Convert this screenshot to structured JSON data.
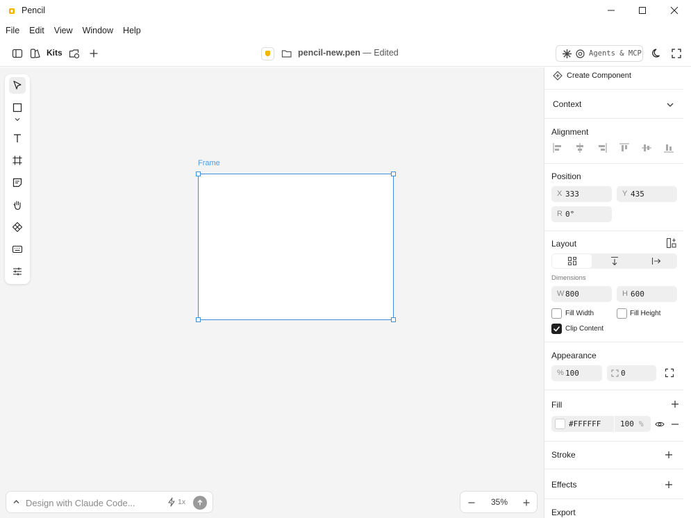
{
  "window": {
    "title": "Pencil",
    "controls": [
      "minimize",
      "maximize",
      "close"
    ]
  },
  "menu": [
    "File",
    "Edit",
    "View",
    "Window",
    "Help"
  ],
  "toolbar": {
    "kits_label": "Kits",
    "file_name": "pencil-new.pen",
    "file_status": " — Edited",
    "agents_label": "Agents & MCP"
  },
  "canvas": {
    "frame_label": "Frame"
  },
  "chat": {
    "placeholder": "Design with Claude Code...",
    "speed": "1x"
  },
  "zoom": {
    "value": "35%"
  },
  "panel": {
    "create_component": "Create Component",
    "context": "Context",
    "alignment": "Alignment",
    "position": {
      "title": "Position",
      "x_label": "X",
      "x_value": "333",
      "y_label": "Y",
      "y_value": "435",
      "r_label": "R",
      "r_value": "0°"
    },
    "layout": {
      "title": "Layout",
      "dimensions_label": "Dimensions",
      "w_label": "W",
      "w_value": "800",
      "h_label": "H",
      "h_value": "600",
      "fill_width": "Fill Width",
      "fill_height": "Fill Height",
      "clip_content": "Clip Content",
      "clip_checked": true
    },
    "appearance": {
      "title": "Appearance",
      "opacity_label": "%",
      "opacity_value": "100",
      "radius_value": "0"
    },
    "fill": {
      "title": "Fill",
      "color": "#FFFFFF",
      "opacity": "100",
      "percent": "%"
    },
    "stroke": "Stroke",
    "effects": "Effects",
    "export": "Export"
  },
  "colors": {
    "selection": "#3b8fe0",
    "canvas_bg": "#f4f4f4",
    "accent_badge": "#f4b400"
  }
}
